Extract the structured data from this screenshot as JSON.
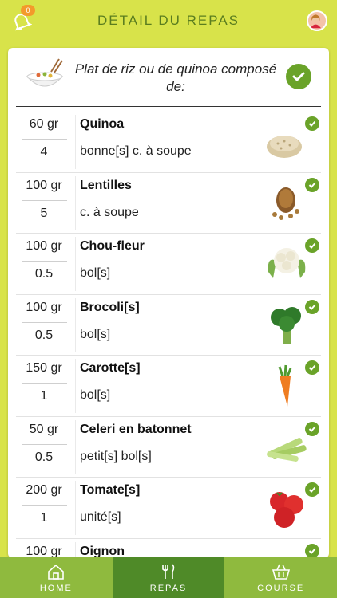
{
  "header": {
    "title": "DÉTAIL DU REPAS",
    "badge": "0",
    "bell_icon": "bell-icon",
    "avatar_icon": "avatar"
  },
  "meal": {
    "title": "Plat de riz ou de quinoa composé de:",
    "icon": "bowl-icon",
    "done_icon": "check-icon"
  },
  "items": [
    {
      "amount": "60 gr",
      "count": "4",
      "name": "Quinoa",
      "unit": "bonne[s] c. à soupe",
      "image": "quinoa"
    },
    {
      "amount": "100 gr",
      "count": "5",
      "name": "Lentilles",
      "unit": "c. à soupe",
      "image": "lentils"
    },
    {
      "amount": "100 gr",
      "count": "0.5",
      "name": "Chou-fleur",
      "unit": "bol[s]",
      "image": "cauliflower"
    },
    {
      "amount": "100 gr",
      "count": "0.5",
      "name": "Brocoli[s]",
      "unit": "bol[s]",
      "image": "broccoli"
    },
    {
      "amount": "150 gr",
      "count": "1",
      "name": "Carotte[s]",
      "unit": "bol[s]",
      "image": "carrot"
    },
    {
      "amount": "50 gr",
      "count": "0.5",
      "name": "Celeri en batonnet",
      "unit": "petit[s] bol[s]",
      "image": "celery"
    },
    {
      "amount": "200 gr",
      "count": "1",
      "name": "Tomate[s]",
      "unit": "unité[s]",
      "image": "tomato"
    },
    {
      "amount": "100 gr",
      "count": "",
      "name": "Oignon",
      "unit": "",
      "image": "onion"
    }
  ],
  "tabs": [
    {
      "label": "HOME",
      "icon": "home-icon"
    },
    {
      "label": "REPAS",
      "icon": "fork-knife-icon",
      "active": true
    },
    {
      "label": "COURSE",
      "icon": "basket-icon"
    }
  ],
  "colors": {
    "accent": "#d8e34a",
    "green": "#6aa329",
    "tab_active": "#4f8a28",
    "tab": "#8fba3e"
  }
}
